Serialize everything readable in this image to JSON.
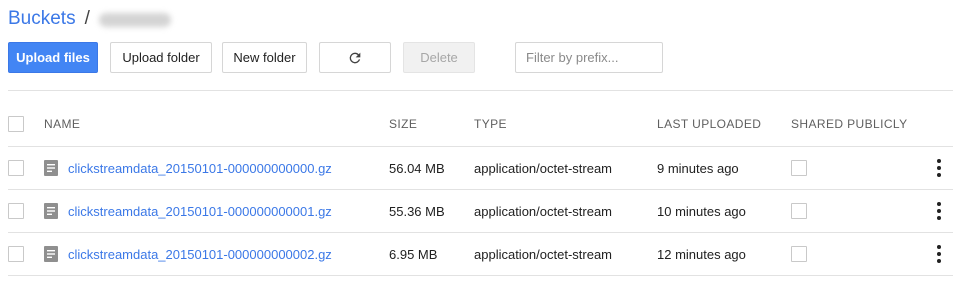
{
  "breadcrumb": {
    "root_label": "Buckets",
    "separator": "/",
    "current_label": ""
  },
  "toolbar": {
    "upload_files_label": "Upload files",
    "upload_folder_label": "Upload folder",
    "new_folder_label": "New folder",
    "refresh_icon": "refresh-icon",
    "delete_label": "Delete",
    "filter_placeholder": "Filter by prefix...",
    "filter_value": ""
  },
  "table": {
    "columns": {
      "name": "NAME",
      "size": "SIZE",
      "type": "TYPE",
      "last_uploaded": "LAST UPLOADED",
      "shared_publicly": "SHARED PUBLICLY"
    },
    "rows": [
      {
        "name": "clickstreamdata_20150101-000000000000.gz",
        "size": "56.04 MB",
        "type": "application/octet-stream",
        "last_uploaded": "9 minutes ago",
        "shared_publicly": false
      },
      {
        "name": "clickstreamdata_20150101-000000000001.gz",
        "size": "55.36 MB",
        "type": "application/octet-stream",
        "last_uploaded": "10 minutes ago",
        "shared_publicly": false
      },
      {
        "name": "clickstreamdata_20150101-000000000002.gz",
        "size": "6.95 MB",
        "type": "application/octet-stream",
        "last_uploaded": "12 minutes ago",
        "shared_publicly": false
      }
    ]
  },
  "colors": {
    "link": "#3b78e7",
    "primary_button": "#4285f4",
    "divider": "#e2e2e2"
  }
}
